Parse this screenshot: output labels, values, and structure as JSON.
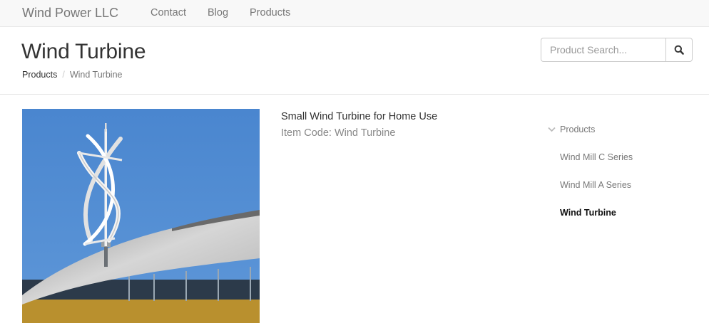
{
  "navbar": {
    "brand": "Wind Power LLC",
    "links": [
      "Contact",
      "Blog",
      "Products"
    ]
  },
  "header": {
    "title": "Wind Turbine",
    "breadcrumb": {
      "parent": "Products",
      "separator": "/",
      "current": "Wind Turbine"
    },
    "search": {
      "placeholder": "Product Search...",
      "icon": "search-icon"
    }
  },
  "product": {
    "name": "Small Wind Turbine for Home Use",
    "item_code": "Item Code: Wind Turbine",
    "image": {
      "icon": "wind-turbine-photo",
      "colors": {
        "sky": "#4b86cf",
        "roof": "#d8d8d8",
        "turbine": "#eeeeee"
      }
    }
  },
  "sidebar": {
    "header": "Products",
    "header_icon": "chevron-down-icon",
    "items": [
      "Wind Mill C Series",
      "Wind Mill A Series",
      "Wind Turbine"
    ]
  }
}
